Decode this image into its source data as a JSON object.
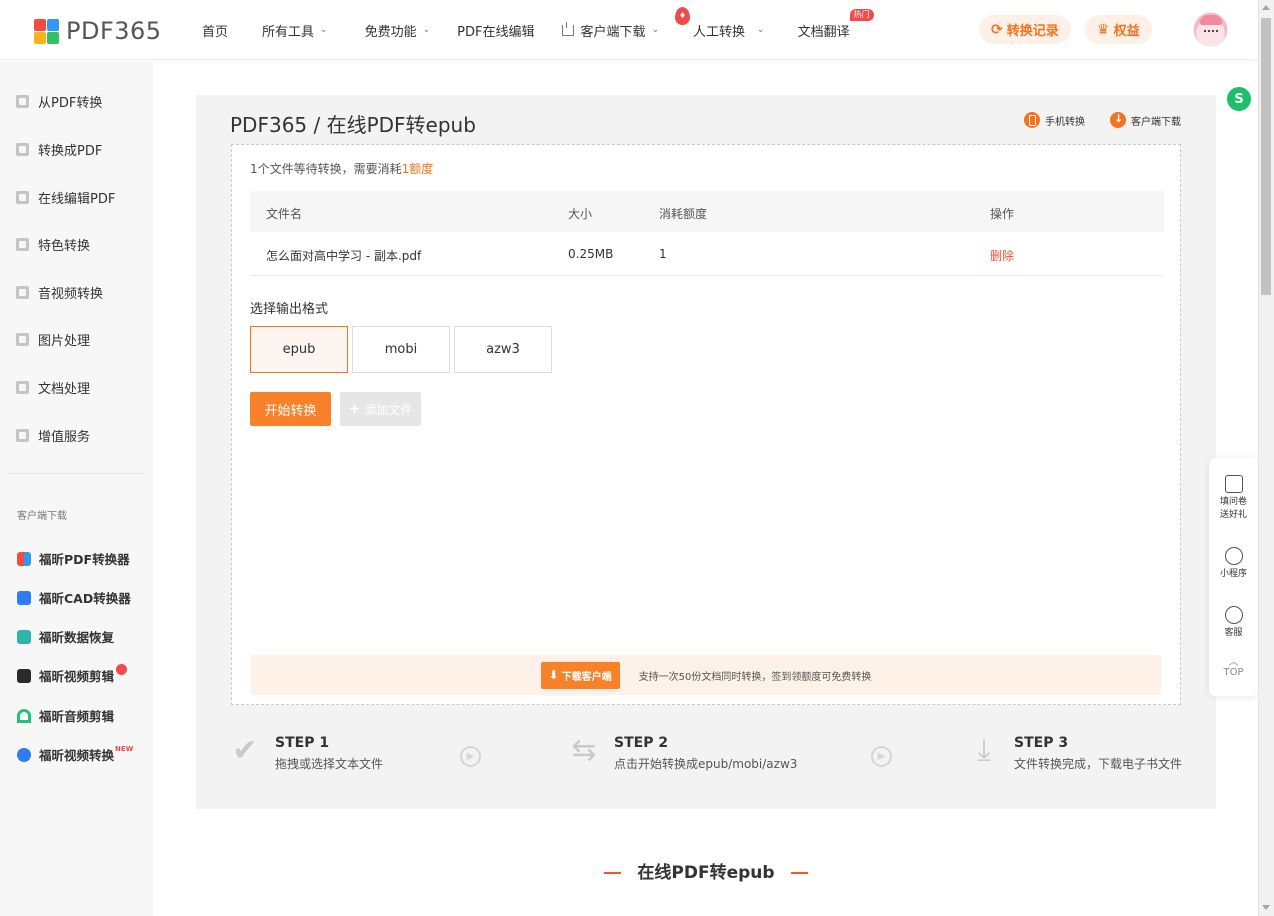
{
  "header": {
    "logo_text": "PDF365",
    "nav": [
      {
        "label": "首页"
      },
      {
        "label": "所有工具"
      },
      {
        "label": "免费功能"
      },
      {
        "label": "PDF在线编辑"
      },
      {
        "label": "客户端下载"
      },
      {
        "label": "人工转换"
      },
      {
        "label": "文档翻译"
      }
    ],
    "hot_badge": "热门",
    "history_label": "转换记录",
    "rights_label": "权益"
  },
  "sidebar": {
    "items": [
      {
        "label": "从PDF转换"
      },
      {
        "label": "转换成PDF"
      },
      {
        "label": "在线编辑PDF"
      },
      {
        "label": "特色转换"
      },
      {
        "label": "音视频转换"
      },
      {
        "label": "图片处理"
      },
      {
        "label": "文档处理"
      },
      {
        "label": "增值服务"
      }
    ],
    "section_label": "客户端下载",
    "apps": [
      {
        "label": "福昕PDF转换器"
      },
      {
        "label": "福昕CAD转换器"
      },
      {
        "label": "福昕数据恢复"
      },
      {
        "label": "福昕视频剪辑"
      },
      {
        "label": "福昕音频剪辑"
      },
      {
        "label": "福昕视频转换"
      }
    ],
    "new_tag": "NEW"
  },
  "main": {
    "title": "PDF365 / 在线PDF转epub",
    "mobile_link": "手机转换",
    "client_link": "客户端下载",
    "count_prefix": "1个文件等待转换，需要消耗",
    "count_highlight": "1额度",
    "table": {
      "headers": [
        "文件名",
        "大小",
        "消耗额度",
        "操作"
      ],
      "rows": [
        {
          "name": "怎么面对高中学习 - 副本.pdf",
          "size": "0.25MB",
          "cost": "1",
          "action": "删除"
        }
      ]
    },
    "format_label": "选择输出格式",
    "formats": [
      "epub",
      "mobi",
      "azw3"
    ],
    "selected_format": "epub",
    "start_label": "开始转换",
    "add_label": "添加文件",
    "promo_btn": "下载客户端",
    "promo_text": "支持一次50份文档同时转换，签到领额度可免费转换",
    "steps": [
      {
        "title": "STEP 1",
        "desc": "拖拽或选择文本文件"
      },
      {
        "title": "STEP 2",
        "desc": "点击开始转换成epub/mobi/azw3"
      },
      {
        "title": "STEP 3",
        "desc": "文件转换完成，下载电子书文件"
      }
    ]
  },
  "section_title": "在线PDF转epub",
  "float_bar": {
    "survey": "填问卷送好礼",
    "miniapp": "小程序",
    "service": "客服",
    "top": "TOP"
  }
}
